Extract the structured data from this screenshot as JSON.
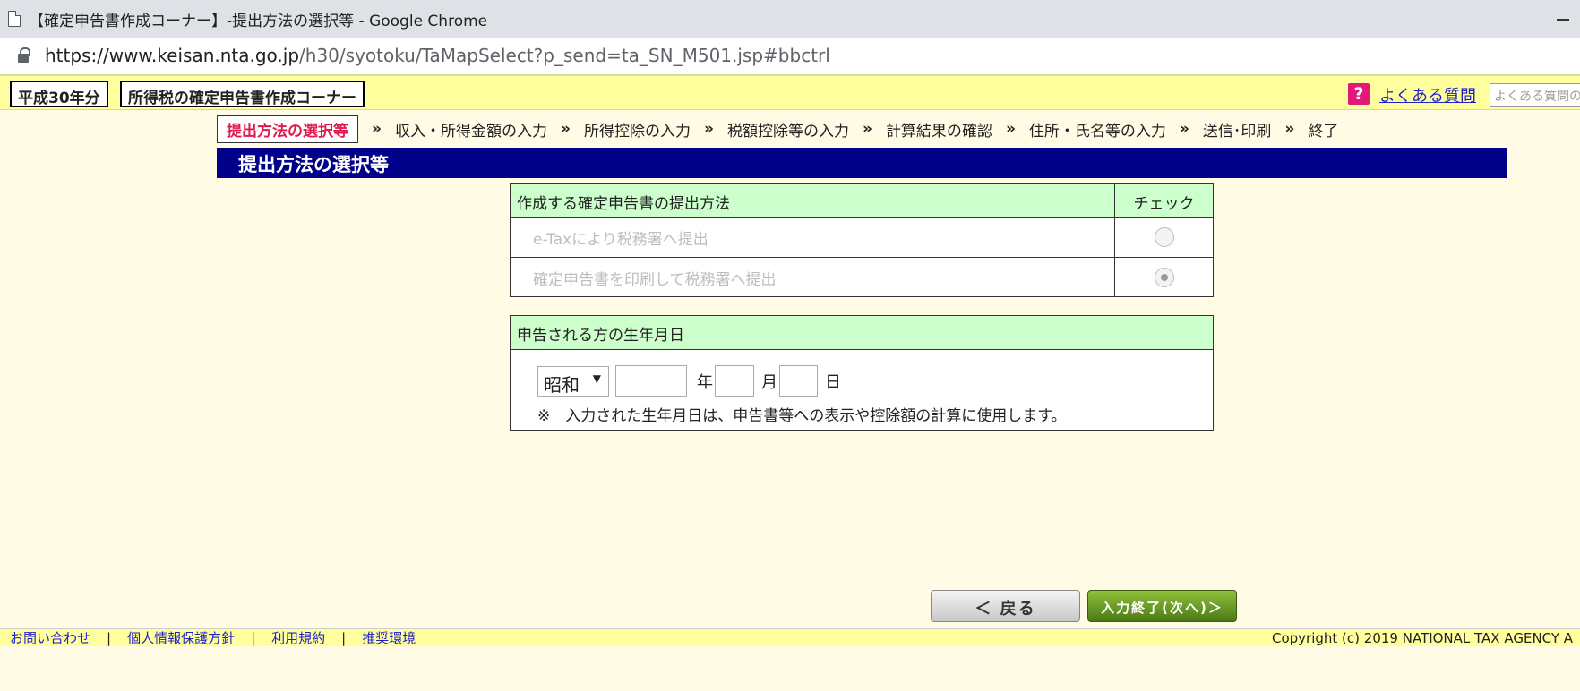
{
  "browser": {
    "title": "【確定申告書作成コーナー】-提出方法の選択等 - Google Chrome",
    "url_host": "https://www.keisan.nta.go.jp",
    "url_path": "/h30/syotoku/TaMapSelect?p_send=ta_SN_M501.jsp#bbctrl"
  },
  "header": {
    "year": "平成30年分",
    "corner": "所得税の確定申告書作成コーナー",
    "faq_icon": "?",
    "faq_link": "よくある質問",
    "faq_search_placeholder": "よくある質問の検"
  },
  "steps": {
    "current": "提出方法の選択等",
    "separator": "»",
    "items": [
      "収入・所得金額の入力",
      "所得控除の入力",
      "税額控除等の入力",
      "計算結果の確認",
      "住所・氏名等の入力",
      "送信･印刷",
      "終了"
    ]
  },
  "section_title": "提出方法の選択等",
  "submission": {
    "header_method": "作成する確定申告書の提出方法",
    "header_check": "チェック",
    "options": [
      {
        "label": "e-Taxにより税務署へ提出",
        "checked": false
      },
      {
        "label": "確定申告書を印刷して税務署へ提出",
        "checked": true
      }
    ]
  },
  "birth": {
    "header": "申告される方の生年月日",
    "era": "昭和",
    "era_arrow": "▼",
    "year_unit": "年",
    "month_unit": "月",
    "day_unit": "日",
    "year_value": "",
    "month_value": "",
    "day_value": "",
    "note": "※　入力された生年月日は、申告書等への表示や控除額の計算に使用します。"
  },
  "buttons": {
    "back": "＜ 戻る",
    "next": "入力終了(次へ)＞"
  },
  "footer": {
    "links": [
      "お問い合わせ",
      "個人情報保護方針",
      "利用規約",
      "推奨環境"
    ],
    "separator": "|",
    "copyright": "Copyright (c) 2019 NATIONAL TAX AGENCY A"
  }
}
